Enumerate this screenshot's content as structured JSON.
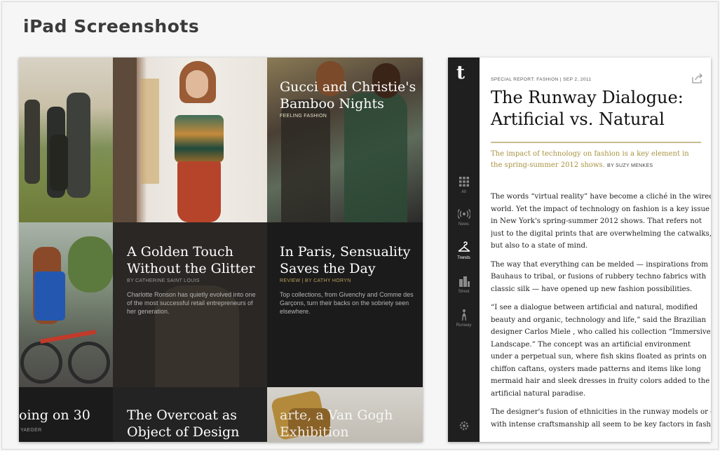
{
  "page": {
    "title": "iPad Screenshots"
  },
  "left_screen": {
    "tiles": [
      {
        "title": "Gucci and Christie's Bamboo Nights",
        "byline": "FEELING FASHION",
        "desc": ""
      },
      {
        "title": "A Golden Touch Without the Glitter",
        "byline": "BY CATHERINE SAINT LOUIS",
        "desc": "Charlotte Ronson has quietly evolved into one of the most successful retail entrepreneurs of her generation."
      },
      {
        "title": "In Paris, Sensuality Saves the Day",
        "byline": "REVIEW | BY CATHY HORYN",
        "desc": "Top collections, from Givenchy and Comme des Garçons, turn their backs on the sobriety seen elsewhere."
      },
      {
        "title": "oing on 30",
        "byline": "YAEGER",
        "desc": ""
      },
      {
        "title": "The Overcoat as Object of Design",
        "byline": "",
        "desc": ""
      },
      {
        "title": "arte, a Van Gogh Exhibition",
        "byline": "",
        "desc": ""
      }
    ]
  },
  "right_screen": {
    "logo": "t",
    "nav": [
      {
        "label": "All",
        "icon": "grid-icon"
      },
      {
        "label": "News",
        "icon": "broadcast-icon"
      },
      {
        "label": "Trends",
        "icon": "hanger-icon"
      },
      {
        "label": "Street",
        "icon": "buildings-icon"
      },
      {
        "label": "Runway",
        "icon": "runway-icon"
      }
    ],
    "settings_icon": "gear-icon",
    "article": {
      "kicker": "SPECIAL REPORT: FASHION | SEP 2, 2011",
      "headline_line1": "The Runway Dialogue:",
      "headline_line2": "Artificial vs. Natural",
      "dek_line1": "The impact of technology on fashion is a key element in",
      "dek_line2": "the spring-summer 2012 shows.",
      "byline": "BY SUZY MENKES",
      "paragraphs": [
        [
          "The words “virtual reality” have become a cliché in the wired",
          "world. Yet the impact of technology on fashion is a key issue",
          "in New York's spring-summer 2012 shows. That refers not",
          "just to the digital prints that are overwhelming the catwalks,",
          "but also to a state of mind."
        ],
        [
          "The way that everything can be melded — inspirations from",
          "Bauhaus to tribal, or fusions of rubbery techno fabrics with",
          "classic silk — have opened up new fashion possibilities."
        ],
        [
          "“I see a dialogue between artificial and natural, modified",
          "beauty and organic, technology and life,” said the Brazilian",
          "designer Carlos Miele , who called his collection “Immersive",
          "Landscape.” The concept was an artificial environment",
          "under a perpetual sun, where fish skins floated as prints on",
          "chiffon caftans, oysters made patterns and items like long",
          "mermaid hair and sleek dresses in fruity colors added to the imag",
          "artificial natural paradise."
        ],
        [
          "The designer's fusion of ethnicities in the runway models or of di",
          "with intense craftsmanship all seem to be key factors in fashion s"
        ]
      ]
    }
  }
}
